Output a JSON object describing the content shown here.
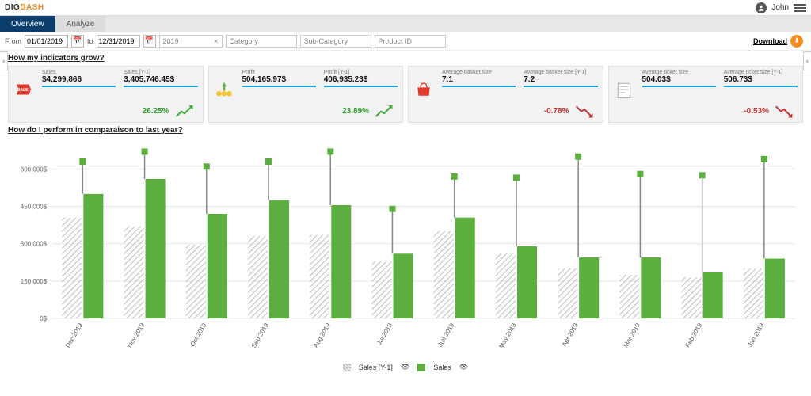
{
  "brand": {
    "part1": "DIG",
    "part2": "DASH"
  },
  "user": {
    "name": "John"
  },
  "tabs": {
    "overview": "Overview",
    "analyze": "Analyze"
  },
  "filters": {
    "from_label": "From",
    "from_value": "01/01/2019",
    "to_label": "to",
    "to_value": "12/31/2019",
    "year": "2019",
    "category_placeholder": "Category",
    "subcategory_placeholder": "Sub-Category",
    "product_placeholder": "Product ID",
    "download": "Download"
  },
  "sections": {
    "indicators": "How my indicators grow?",
    "comparison": "How do I perform in comparaison to last year?"
  },
  "kpi": [
    {
      "icon": "sale",
      "label": "Sales",
      "value": "$4,299,866",
      "label_prev": "Sales [Y-1]",
      "value_prev": "3,405,746.45$",
      "pct": "26.25%",
      "dir": "up"
    },
    {
      "icon": "profit",
      "label": "Profit",
      "value": "504,165.97$",
      "label_prev": "Profit [Y-1]",
      "value_prev": "406,935.23$",
      "pct": "23.89%",
      "dir": "up"
    },
    {
      "icon": "basket",
      "label": "Average basket size",
      "value": "7.1",
      "label_prev": "Average basket size [Y-1]",
      "value_prev": "7.2",
      "pct": "-0.78%",
      "dir": "down"
    },
    {
      "icon": "ticket",
      "label": "Average ticket size",
      "value": "504.03$",
      "label_prev": "Average ticket size [Y-1]",
      "value_prev": "506.73$",
      "pct": "-0.53%",
      "dir": "down"
    }
  ],
  "legend": {
    "prev": "Sales [Y-1]",
    "curr": "Sales"
  },
  "chart_data": {
    "type": "bar",
    "ylabel": "",
    "ylim": [
      0,
      600000
    ],
    "yticks": [
      "0$",
      "150,000$",
      "300,000$",
      "450,000$",
      "600,000$"
    ],
    "categories": [
      "Dec 2019",
      "Nov 2019",
      "Oct 2019",
      "Sep 2019",
      "Aug 2019",
      "Jul 2019",
      "Jun 2019",
      "May 2019",
      "Apr 2019",
      "Mar 2019",
      "Feb 2019",
      "Jan 2019"
    ],
    "series": [
      {
        "name": "Sales [Y-1]",
        "values": [
          405000,
          370000,
          295000,
          330000,
          335000,
          230000,
          350000,
          260000,
          200000,
          175000,
          165000,
          200000
        ]
      },
      {
        "name": "Sales",
        "values": [
          500000,
          560000,
          420000,
          475000,
          455000,
          260000,
          405000,
          290000,
          245000,
          245000,
          185000,
          240000
        ]
      }
    ],
    "target_markers": [
      630000,
      670000,
      610000,
      630000,
      670000,
      440000,
      570000,
      565000,
      650000,
      580000,
      575000,
      640000
    ]
  }
}
